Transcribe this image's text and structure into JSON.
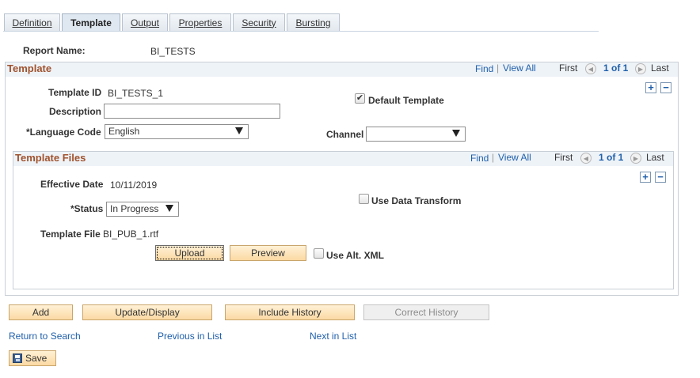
{
  "tabs": [
    {
      "label": "Definition"
    },
    {
      "label": "Template",
      "active": true
    },
    {
      "label": "Output"
    },
    {
      "label": "Properties"
    },
    {
      "label": "Security"
    },
    {
      "label": "Bursting"
    }
  ],
  "report": {
    "name_label": "Report Name:",
    "name_value": "BI_TESTS"
  },
  "template_group": {
    "title": "Template",
    "nav": {
      "find": "Find",
      "sep": "|",
      "view_all": "View All",
      "first": "First",
      "count": "1 of 1",
      "last": "Last"
    },
    "template_id_label": "Template ID",
    "template_id_value": "BI_TESTS_1",
    "description_label": "Description",
    "description_value": "",
    "default_template_label": "Default Template",
    "default_template_checked": true,
    "language_label": "*Language Code",
    "language_value": "English",
    "channel_label": "Channel",
    "channel_value": ""
  },
  "template_files": {
    "title": "Template Files",
    "nav": {
      "find": "Find",
      "sep": "|",
      "view_all": "View All",
      "first": "First",
      "count": "1 of 1",
      "last": "Last"
    },
    "effective_date_label": "Effective Date",
    "effective_date_value": "10/11/2019",
    "status_label": "*Status",
    "status_value": "In Progress",
    "use_data_transform_label": "Use Data Transform",
    "template_file_label": "Template File",
    "template_file_value": "BI_PUB_1.rtf",
    "upload_label": "Upload",
    "preview_label": "Preview",
    "use_alt_xml_label": "Use Alt. XML"
  },
  "actions": {
    "add": "Add",
    "update_display": "Update/Display",
    "include_history": "Include History",
    "correct_history": "Correct History"
  },
  "links": {
    "return_to_search": "Return to Search",
    "previous_in_list": "Previous in List",
    "next_in_list": "Next in List"
  },
  "save": {
    "label": "Save"
  },
  "icons": {
    "add": "plus-icon",
    "delete": "minus-icon",
    "prev": "prev-arrow-icon",
    "next": "next-arrow-icon",
    "save": "floppy-disk-icon"
  }
}
